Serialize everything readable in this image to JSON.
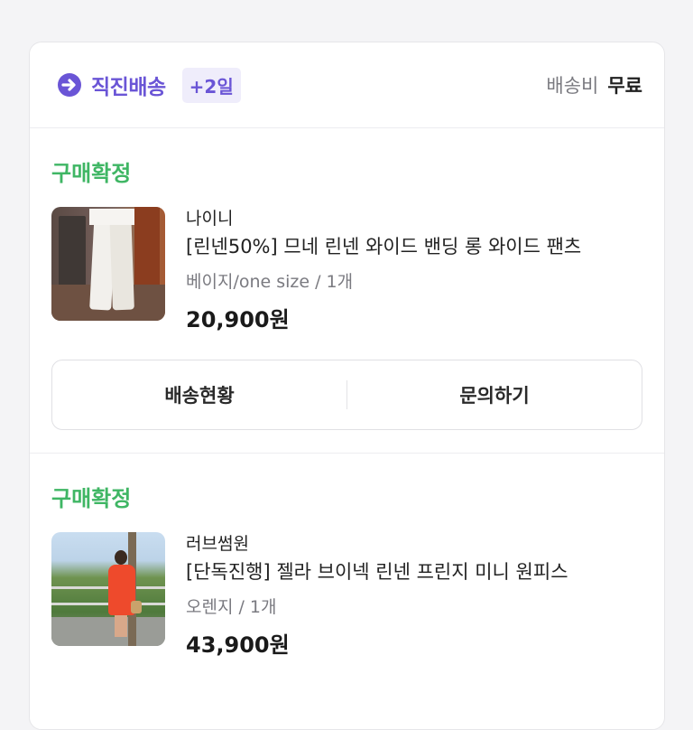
{
  "header": {
    "shipping_label": "직진배송",
    "shipping_icon": "arrow-circle-icon",
    "days_badge": "+2일",
    "fee_label": "배송비",
    "fee_value": "무료"
  },
  "colors": {
    "accent": "#6a55d6",
    "status_green": "#3fb664"
  },
  "orders": [
    {
      "status": "구매확정",
      "brand": "나이니",
      "title": "[린넨50%] 므네 린넨 와이드 밴딩 롱 와이드 팬츠",
      "option": "베이지/one size / 1개",
      "price": "20,900원",
      "actions": [
        "배송현황",
        "문의하기"
      ]
    },
    {
      "status": "구매확정",
      "brand": "러브썸원",
      "title": "[단독진행] 젤라 브이넥 린넨 프린지 미니 원피스",
      "option": "오렌지 / 1개",
      "price": "43,900원"
    }
  ]
}
